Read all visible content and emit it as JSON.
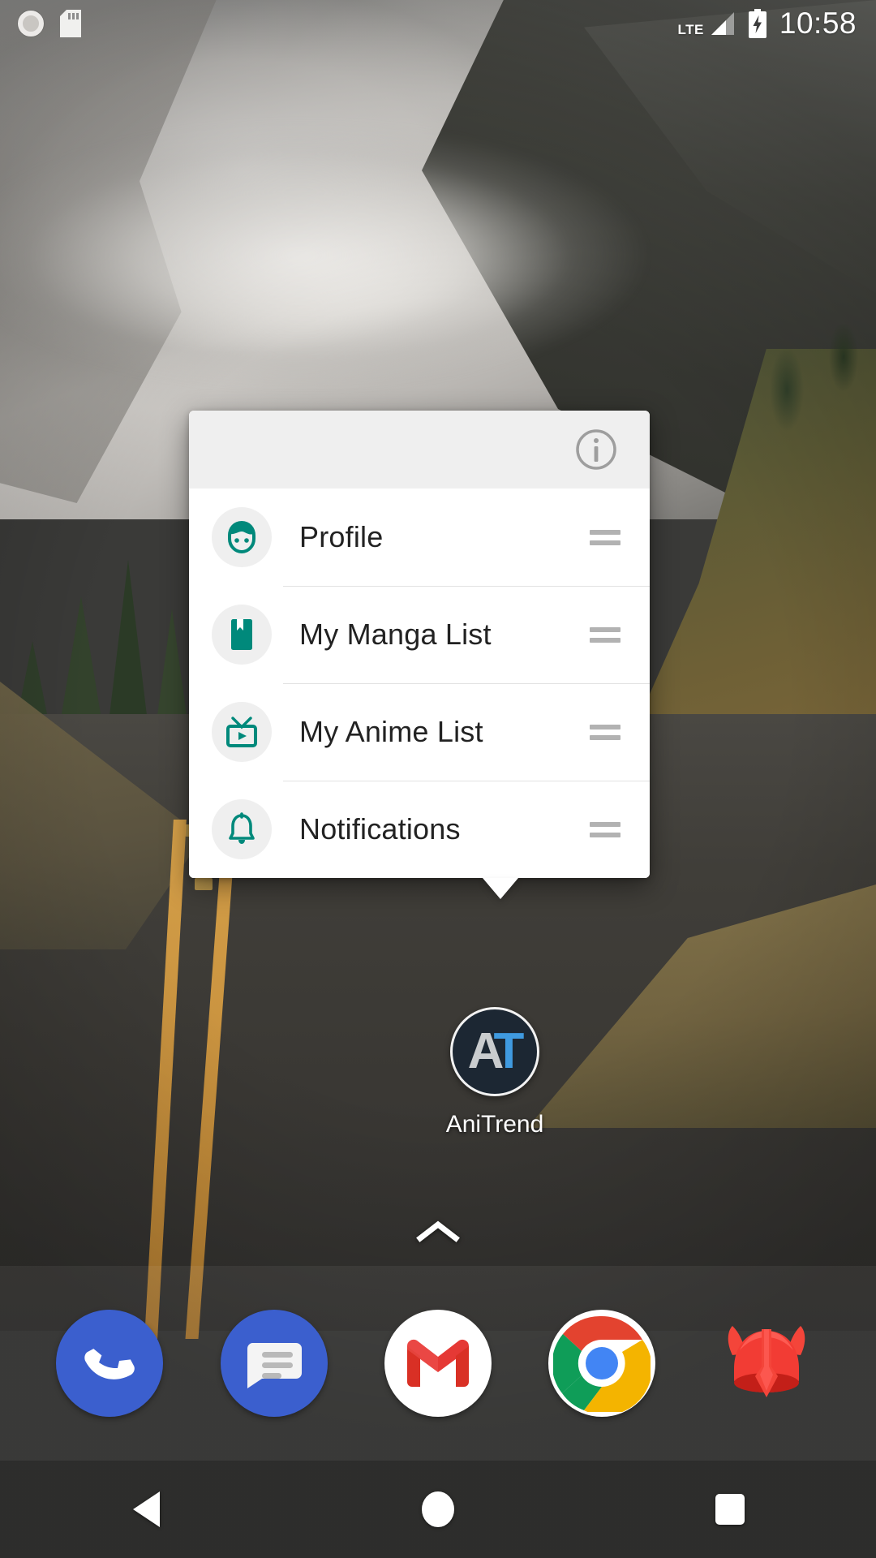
{
  "status_bar": {
    "time": "10:58",
    "network_type": "LTE",
    "left_icons": [
      {
        "name": "screen-record-icon",
        "glyph": "record"
      },
      {
        "name": "sd-card-icon",
        "glyph": "sdcard"
      }
    ],
    "right_icons": [
      {
        "name": "signal-icon",
        "glyph": "signal-bars"
      },
      {
        "name": "battery-charging-icon",
        "glyph": "battery-bolt"
      }
    ]
  },
  "shortcut_popup": {
    "header": {
      "info_icon_label": "App info"
    },
    "items": [
      {
        "label": "Profile",
        "icon": "profile-avatar-icon",
        "color": "#00897B"
      },
      {
        "label": "My Manga List",
        "icon": "book-bookmark-icon",
        "color": "#00897B"
      },
      {
        "label": "My Anime List",
        "icon": "television-play-icon",
        "color": "#00897B"
      },
      {
        "label": "Notifications",
        "icon": "bell-icon",
        "color": "#00897B"
      }
    ],
    "drag_handle_label": "Reorder shortcut"
  },
  "home": {
    "app": {
      "label": "AniTrend",
      "icon_initials_first": "A",
      "icon_initials_second": "T",
      "icon_bg": "#1C2733",
      "initials_first_color": "#C9CCCE",
      "initials_second_color": "#3F9AE0"
    },
    "drawer_handle_label": "Open app drawer"
  },
  "dock": {
    "items": [
      {
        "label": "Phone",
        "icon": "phone-icon",
        "bg": "#3B5FCE"
      },
      {
        "label": "Messages",
        "icon": "messages-icon",
        "bg": "#3B5FCE"
      },
      {
        "label": "Gmail",
        "icon": "gmail-icon",
        "bg": "#FFFFFF"
      },
      {
        "label": "Chrome",
        "icon": "chrome-icon",
        "bg": "#FFFFFF"
      },
      {
        "label": "Opera",
        "icon": "opera-viking-helmet-icon",
        "bg": "transparent"
      }
    ]
  },
  "nav_bar": {
    "back_label": "Back",
    "home_label": "Home",
    "recents_label": "Recent apps"
  },
  "theme": {
    "accent": "#00897B",
    "popup_bg": "#FFFFFF",
    "popup_header_bg": "#EFEFEF",
    "divider": "#E2E2E2",
    "text_primary": "#222222",
    "handle_gray": "#B2B2B2"
  }
}
